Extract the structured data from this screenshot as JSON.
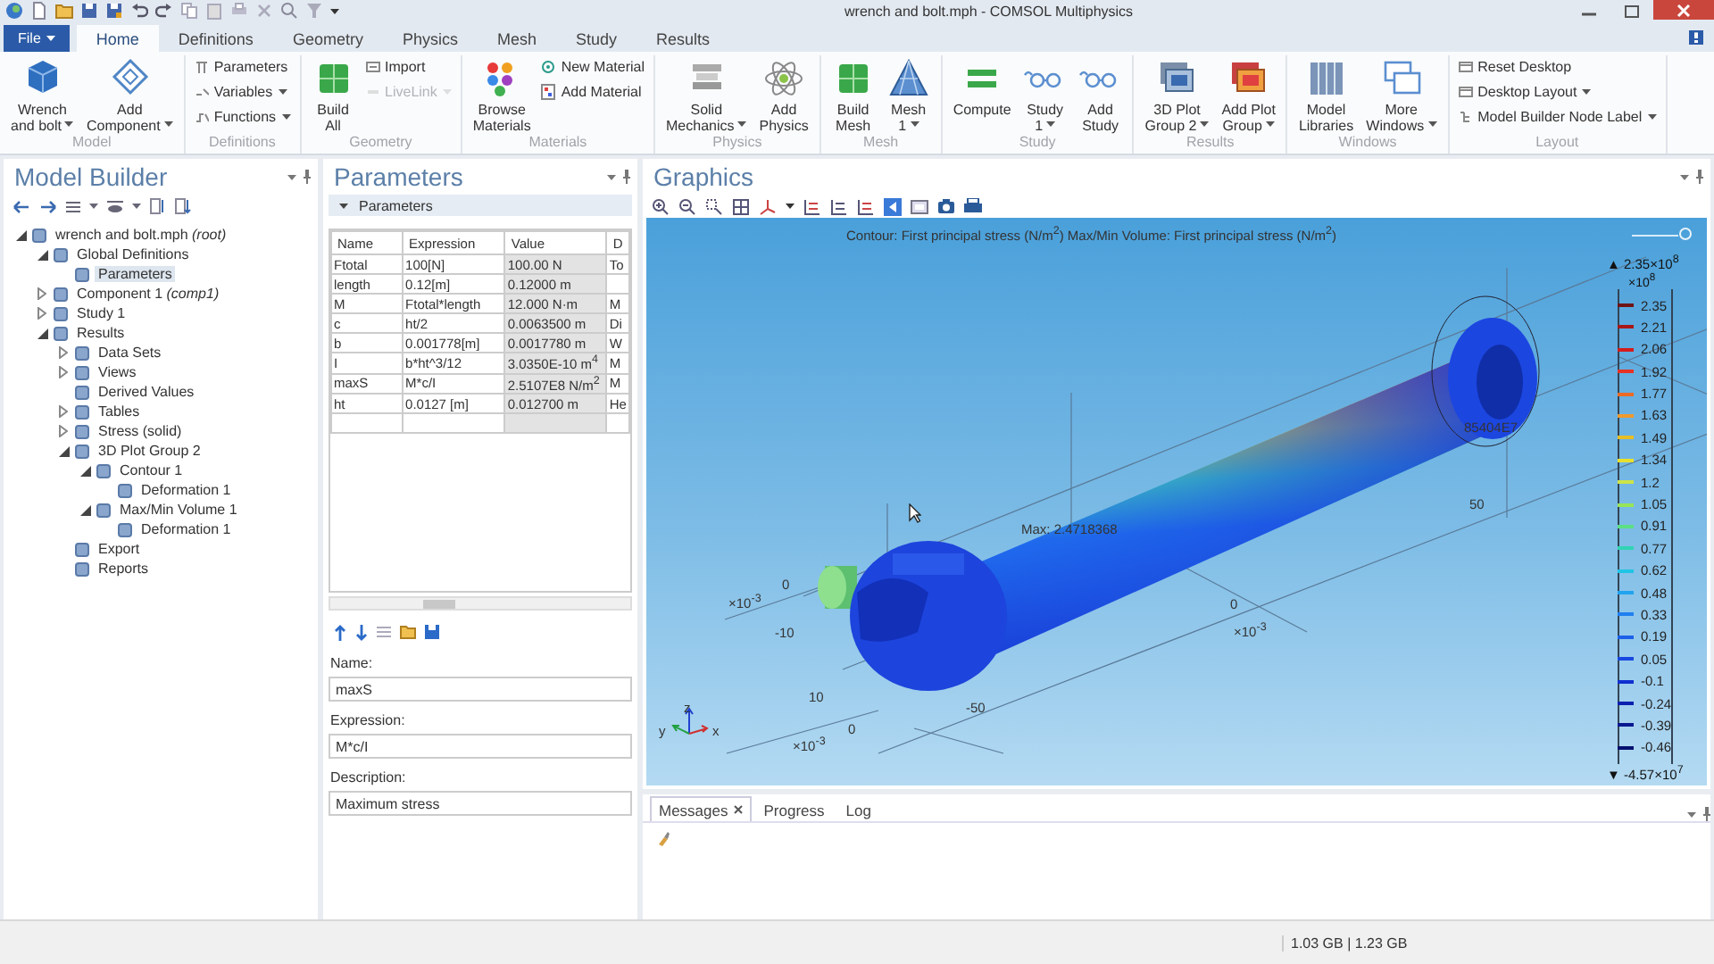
{
  "window": {
    "title": "wrench and bolt.mph - COMSOL Multiphysics"
  },
  "file_menu": {
    "label": "File"
  },
  "ribbon_tabs": [
    {
      "label": "Home",
      "selected": true
    },
    {
      "label": "Definitions",
      "selected": false
    },
    {
      "label": "Geometry",
      "selected": false
    },
    {
      "label": "Physics",
      "selected": false
    },
    {
      "label": "Mesh",
      "selected": false
    },
    {
      "label": "Study",
      "selected": false
    },
    {
      "label": "Results",
      "selected": false
    }
  ],
  "ribbon_groups": [
    {
      "label": "Model",
      "items": [
        {
          "kind": "large",
          "lines": [
            "Wrench",
            "and bolt"
          ],
          "dropdown": true,
          "disabled": false
        },
        {
          "kind": "large",
          "lines": [
            "Add",
            "Component"
          ],
          "dropdown": true,
          "disabled": false
        }
      ]
    },
    {
      "label": "Definitions",
      "items": [
        {
          "kind": "small",
          "lines": [
            "Parameters"
          ],
          "dropdown": false,
          "disabled": false
        },
        {
          "kind": "small",
          "lines": [
            "Variables"
          ],
          "dropdown": true,
          "disabled": false
        },
        {
          "kind": "small",
          "lines": [
            "Functions"
          ],
          "dropdown": true,
          "disabled": false
        }
      ]
    },
    {
      "label": "Geometry",
      "items": [
        {
          "kind": "large",
          "lines": [
            "Build",
            "All"
          ],
          "dropdown": false,
          "disabled": false
        },
        {
          "kind": "small",
          "lines": [
            "Import"
          ],
          "dropdown": false,
          "disabled": false
        },
        {
          "kind": "small",
          "lines": [
            "LiveLink"
          ],
          "dropdown": true,
          "disabled": true
        }
      ]
    },
    {
      "label": "Materials",
      "items": [
        {
          "kind": "large",
          "lines": [
            "Browse",
            "Materials"
          ],
          "dropdown": false,
          "disabled": false
        },
        {
          "kind": "small",
          "lines": [
            "New Material"
          ],
          "dropdown": false,
          "disabled": false
        },
        {
          "kind": "small",
          "lines": [
            "Add Material"
          ],
          "dropdown": false,
          "disabled": false
        }
      ]
    },
    {
      "label": "Physics",
      "items": [
        {
          "kind": "large",
          "lines": [
            "Solid",
            "Mechanics"
          ],
          "dropdown": true,
          "disabled": false
        },
        {
          "kind": "large",
          "lines": [
            "Add",
            "Physics"
          ],
          "dropdown": false,
          "disabled": false
        }
      ]
    },
    {
      "label": "Mesh",
      "items": [
        {
          "kind": "large",
          "lines": [
            "Build",
            "Mesh"
          ],
          "dropdown": false,
          "disabled": false
        },
        {
          "kind": "large",
          "lines": [
            "Mesh",
            "1"
          ],
          "dropdown": true,
          "disabled": false
        }
      ]
    },
    {
      "label": "Study",
      "items": [
        {
          "kind": "large",
          "lines": [
            "Compute"
          ],
          "dropdown": false,
          "disabled": false
        },
        {
          "kind": "large",
          "lines": [
            "Study",
            "1"
          ],
          "dropdown": true,
          "disabled": false
        },
        {
          "kind": "large",
          "lines": [
            "Add",
            "Study"
          ],
          "dropdown": false,
          "disabled": false
        }
      ]
    },
    {
      "label": "Results",
      "items": [
        {
          "kind": "large",
          "lines": [
            "3D Plot",
            "Group 2"
          ],
          "dropdown": true,
          "disabled": false
        },
        {
          "kind": "large",
          "lines": [
            "Add Plot",
            "Group"
          ],
          "dropdown": true,
          "disabled": false
        }
      ]
    },
    {
      "label": "Windows",
      "items": [
        {
          "kind": "large",
          "lines": [
            "Model",
            "Libraries"
          ],
          "dropdown": false,
          "disabled": false
        },
        {
          "kind": "large",
          "lines": [
            "More",
            "Windows"
          ],
          "dropdown": true,
          "disabled": false
        }
      ]
    },
    {
      "label": "Layout",
      "items": [
        {
          "kind": "small",
          "lines": [
            "Reset Desktop"
          ],
          "dropdown": false,
          "disabled": false
        },
        {
          "kind": "small",
          "lines": [
            "Desktop Layout"
          ],
          "dropdown": true,
          "disabled": false
        },
        {
          "kind": "small",
          "lines": [
            "Model Builder Node Label"
          ],
          "dropdown": true,
          "disabled": false
        }
      ]
    }
  ],
  "model_builder": {
    "title": "Model Builder",
    "tree": [
      {
        "label": "wrench and bolt.mph *(root)*",
        "expanded": true,
        "selected": false,
        "children": [
          {
            "label": "Global Definitions",
            "expanded": true,
            "selected": false,
            "children": [
              {
                "label": "Parameters",
                "selected": true
              }
            ]
          },
          {
            "label": "Component 1 *(comp1)*",
            "expanded": false,
            "selected": false
          },
          {
            "label": "Study 1",
            "expanded": false,
            "selected": false
          },
          {
            "label": "Results",
            "expanded": true,
            "selected": false,
            "children": [
              {
                "label": "Data Sets",
                "expanded": false,
                "selected": false
              },
              {
                "label": "Views",
                "expanded": false,
                "selected": false
              },
              {
                "label": "Derived Values",
                "selected": false
              },
              {
                "label": "Tables",
                "expanded": false,
                "selected": false
              },
              {
                "label": "Stress (solid)",
                "expanded": false,
                "selected": false
              },
              {
                "label": "3D Plot Group 2",
                "expanded": true,
                "selected": false,
                "children": [
                  {
                    "label": "Contour 1",
                    "expanded": true,
                    "selected": false,
                    "children": [
                      {
                        "label": "Deformation 1",
                        "selected": false
                      }
                    ]
                  },
                  {
                    "label": "Max/Min Volume 1",
                    "expanded": true,
                    "selected": false,
                    "children": [
                      {
                        "label": "Deformation 1",
                        "selected": false
                      }
                    ]
                  }
                ]
              },
              {
                "label": "Export",
                "selected": false
              },
              {
                "label": "Reports",
                "selected": false
              }
            ]
          }
        ]
      }
    ]
  },
  "parameters": {
    "title": "Parameters",
    "section": "Parameters",
    "table": {
      "columns": [
        "Name",
        "Expression",
        "Value",
        "D"
      ],
      "rows": [
        [
          "Ftotal",
          "100[N]",
          "100.00 N",
          "To"
        ],
        [
          "length",
          "0.12[m]",
          "0.12000 m",
          ""
        ],
        [
          "M",
          "Ftotal*length",
          "12.000 N·m",
          "M"
        ],
        [
          "c",
          "ht/2",
          "0.0063500 m",
          "Di"
        ],
        [
          "b",
          "0.001778[m]",
          "0.0017780 m",
          "W"
        ],
        [
          "I",
          "b*ht^3/12",
          "3.0350E-10 m$^{4}$",
          "M"
        ],
        [
          "maxS",
          "M*c/I",
          "2.5107E8 N/m$^{2}$",
          "M"
        ],
        [
          "ht",
          "0.0127  [m]",
          "0.012700 m",
          "He"
        ]
      ]
    },
    "name_label": "Name:",
    "name_value": "maxS",
    "expression_label": "Expression:",
    "expression_value": "M*c/I",
    "description_label": "Description:",
    "description_value": "Maximum stress"
  },
  "graphics": {
    "title": "Graphics",
    "plot_title": "Contour: First principal stress (N/m$^{2}$)  Max/Min Volume: First principal stress (N/m$^{2}$)",
    "axis_labels": [
      "×10$^{-3}$",
      "0",
      "-10",
      "10",
      "×10$^{-3}$",
      "0",
      "-50",
      "0",
      "×10$^{-3}$",
      "50"
    ],
    "annotations": [
      "Max: 2.4718368",
      "85404E7"
    ],
    "triad": [
      "y",
      "z",
      "x"
    ],
    "legend": {
      "top": "▲ 2.35×10$^{8}$",
      "scale": "×10$^{8}$",
      "bottom": "▼ -4.57×10$^{7}$",
      "ticks": [
        {
          "label": "2.35",
          "color": "#6e1414"
        },
        {
          "label": "2.21",
          "color": "#a81818"
        },
        {
          "label": "2.06",
          "color": "#d41c1c"
        },
        {
          "label": "1.92",
          "color": "#e83224"
        },
        {
          "label": "1.77",
          "color": "#ec6a24"
        },
        {
          "label": "1.63",
          "color": "#f09a2c"
        },
        {
          "label": "1.49",
          "color": "#e8be24"
        },
        {
          "label": "1.34",
          "color": "#e8e02c"
        },
        {
          "label": "1.2",
          "color": "#cce448"
        },
        {
          "label": "1.05",
          "color": "#98e458"
        },
        {
          "label": "0.91",
          "color": "#5ce084"
        },
        {
          "label": "0.77",
          "color": "#30d4b4"
        },
        {
          "label": "0.62",
          "color": "#20c4e4"
        },
        {
          "label": "0.48",
          "color": "#20a4f0"
        },
        {
          "label": "0.33",
          "color": "#2080f0"
        },
        {
          "label": "0.19",
          "color": "#1c60e8"
        },
        {
          "label": "0.05",
          "color": "#1848e0"
        },
        {
          "label": "-0.1",
          "color": "#1030d0"
        },
        {
          "label": "-0.24",
          "color": "#0c20b0"
        },
        {
          "label": "-0.39",
          "color": "#081890"
        },
        {
          "label": "-0.46",
          "color": "#061070"
        }
      ]
    }
  },
  "messages": {
    "tabs": [
      {
        "label": "Messages",
        "selected": true,
        "closable": true
      },
      {
        "label": "Progress",
        "selected": false,
        "closable": false
      },
      {
        "label": "Log",
        "selected": false,
        "closable": false
      }
    ]
  },
  "status_bar": {
    "memory": "1.03 GB | 1.23 GB"
  }
}
